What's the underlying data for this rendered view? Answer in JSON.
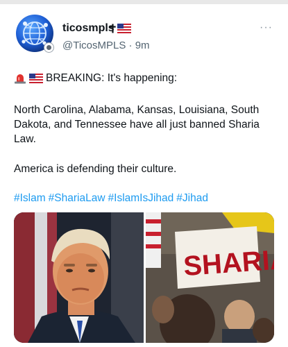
{
  "post": {
    "display_name": "ticosmpls",
    "name_flags": [
      "cross-icon",
      "us-flag-icon"
    ],
    "handle": "@TicosMPLS",
    "separator": "·",
    "time": "9m",
    "more_label": "···",
    "breaking_label": "BREAKING: It's happening:",
    "paragraph_1": "North Carolina, Alabama, Kansas, Louisiana, South Dakota, and Tennessee have all just banned Sharia Law.",
    "paragraph_2": "America is defending their culture.",
    "hashtags": [
      "#Islam",
      "#ShariaLaw",
      "#IslamIsJihad",
      "#Jihad"
    ],
    "media": {
      "right_image_sign_text": "SHARIA"
    }
  },
  "colors": {
    "link": "#1d9bf0",
    "secondary_text": "#536471",
    "primary_text": "#0f1419",
    "siren_red": "#e0322f"
  }
}
